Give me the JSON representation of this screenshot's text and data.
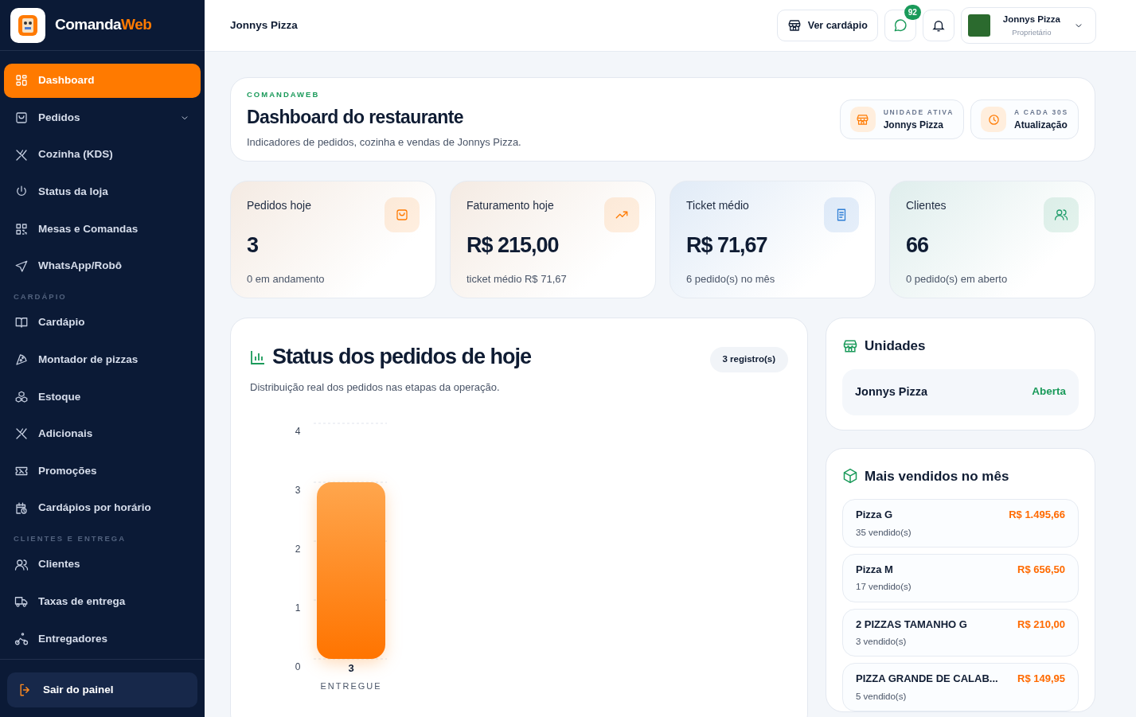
{
  "brand": {
    "part_1": "Comanda",
    "part_2": "Web"
  },
  "sidebar": {
    "items": [
      {
        "kind": "item",
        "label": "Dashboard",
        "selected": true
      },
      {
        "kind": "item",
        "label": "Pedidos",
        "selected": false,
        "expandable": true
      },
      {
        "kind": "item",
        "label": "Cozinha (KDS)",
        "selected": false
      },
      {
        "kind": "item",
        "label": "Status da loja",
        "selected": false
      },
      {
        "kind": "item",
        "label": "Mesas e Comandas",
        "selected": false
      },
      {
        "kind": "item",
        "label": "WhatsApp/Robô",
        "selected": false
      },
      {
        "kind": "section",
        "label": "CARDÁPIO"
      },
      {
        "kind": "item",
        "label": "Cardápio",
        "selected": false
      },
      {
        "kind": "item",
        "label": "Montador de pizzas",
        "selected": false
      },
      {
        "kind": "item",
        "label": "Estoque",
        "selected": false
      },
      {
        "kind": "item",
        "label": "Adicionais",
        "selected": false
      },
      {
        "kind": "item",
        "label": "Promoções",
        "selected": false
      },
      {
        "kind": "item",
        "label": "Cardápios por horário",
        "selected": false
      },
      {
        "kind": "section",
        "label": "CLIENTES E ENTREGA"
      },
      {
        "kind": "item",
        "label": "Clientes",
        "selected": false
      },
      {
        "kind": "item",
        "label": "Taxas de entrega",
        "selected": false
      },
      {
        "kind": "item",
        "label": "Entregadores",
        "selected": false
      }
    ],
    "logout": "Sair do painel"
  },
  "topbar": {
    "title": "Jonnys Pizza",
    "menu_button": "Ver cardápio",
    "chat_badge": "92",
    "user": {
      "name": "Jonnys Pizza",
      "role": "Proprietário"
    }
  },
  "header": {
    "eyebrow": "COMANDAWEB",
    "title": "Dashboard do restaurante",
    "subtitle": "Indicadores de pedidos, cozinha e vendas de Jonnys Pizza.",
    "chips": [
      {
        "label": "UNIDADE ATIVA",
        "value": "Jonnys Pizza"
      },
      {
        "label": "A CADA 30S",
        "value": "Atualização"
      }
    ]
  },
  "stats": [
    {
      "label": "Pedidos hoje",
      "value": "3",
      "note": "0 em andamento",
      "color": "#ff7a00"
    },
    {
      "label": "Faturamento hoje",
      "value": "R$ 215,00",
      "note": "ticket médio R$ 71,67",
      "color": "#ff7a00"
    },
    {
      "label": "Ticket médio",
      "value": "R$ 71,67",
      "note": "6 pedido(s) no mês",
      "color": "#2f7fd6"
    },
    {
      "label": "Clientes",
      "value": "66",
      "note": "0 pedido(s) em aberto",
      "color": "#1f9d6b"
    }
  ],
  "status_panel": {
    "title": "Status dos pedidos de hoje",
    "subtitle": "Distribuição real dos pedidos nas etapas da operação.",
    "badge": "3 registro(s)",
    "chart_data": {
      "type": "bar",
      "categories": [
        "ENTREGUE"
      ],
      "values": [
        3
      ],
      "ylim": [
        0,
        4
      ],
      "yticks": [
        0,
        1,
        2,
        3,
        4
      ],
      "grid": true,
      "data_labels": true
    }
  },
  "units": {
    "title": "Unidades",
    "items": [
      {
        "name": "Jonnys Pizza",
        "status": "Aberta"
      }
    ]
  },
  "top_sellers": {
    "title": "Mais vendidos no mês",
    "items": [
      {
        "name": "Pizza G",
        "sold": "35 vendido(s)",
        "total": "R$ 1.495,66"
      },
      {
        "name": "Pizza M",
        "sold": "17 vendido(s)",
        "total": "R$ 656,50"
      },
      {
        "name": "2 PIZZAS TAMANHO G",
        "sold": "3 vendido(s)",
        "total": "R$ 210,00"
      },
      {
        "name": "PIZZA GRANDE DE CALAB...",
        "sold": "5 vendido(s)",
        "total": "R$ 149,95"
      }
    ]
  }
}
